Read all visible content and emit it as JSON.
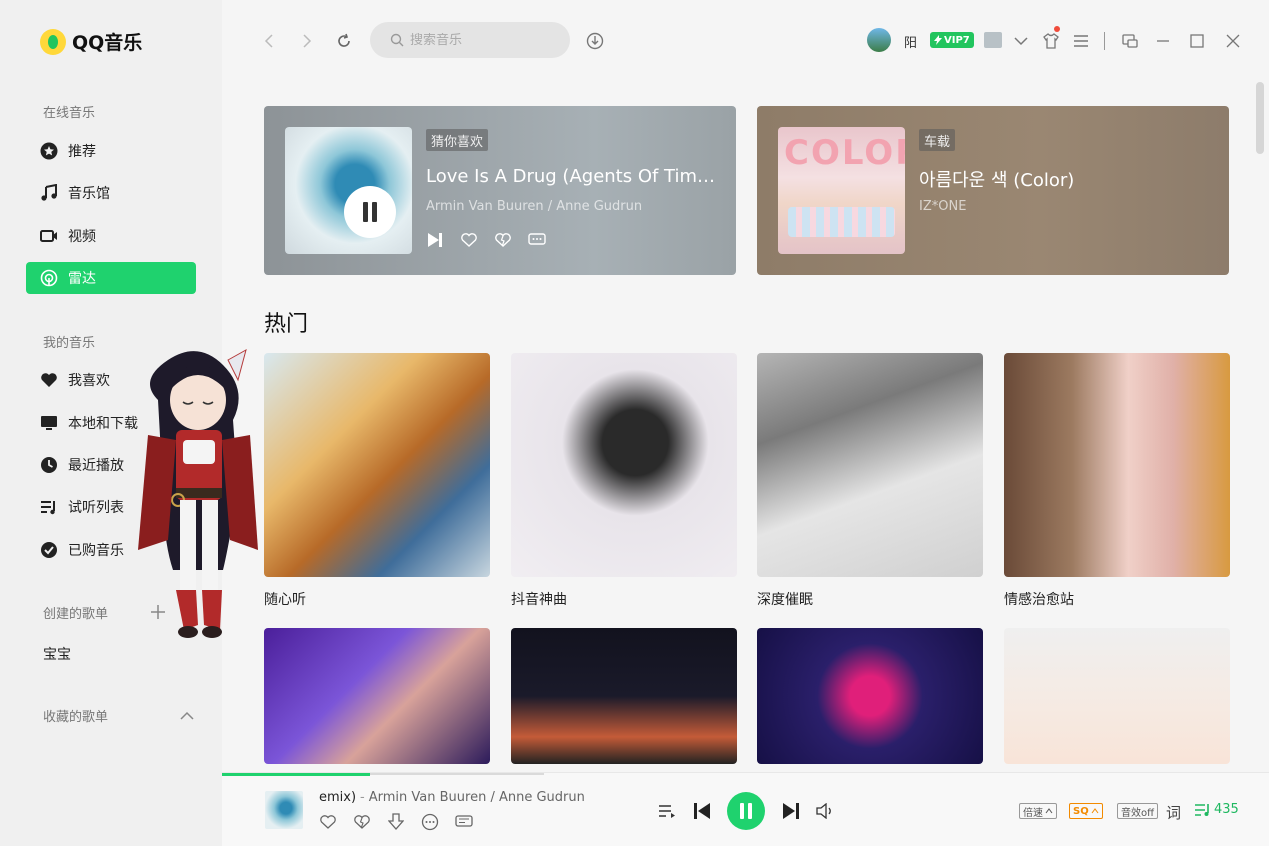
{
  "app": {
    "name": "QQ音乐",
    "accent": "#1fd26e"
  },
  "sidebar": {
    "online_label": "在线音乐",
    "online_items": [
      {
        "label": "推荐",
        "icon": "star-icon"
      },
      {
        "label": "音乐馆",
        "icon": "music-note-icon"
      },
      {
        "label": "视频",
        "icon": "video-icon"
      },
      {
        "label": "雷达",
        "icon": "radar-icon",
        "active": true
      }
    ],
    "my_label": "我的音乐",
    "my_items": [
      {
        "label": "我喜欢",
        "icon": "heart-icon"
      },
      {
        "label": "本地和下载",
        "icon": "monitor-icon"
      },
      {
        "label": "最近播放",
        "icon": "clock-icon"
      },
      {
        "label": "试听列表",
        "icon": "playlist-icon"
      },
      {
        "label": "已购音乐",
        "icon": "check-circle-icon"
      }
    ],
    "created_label": "创建的歌单",
    "created_playlists": [
      "宝宝"
    ],
    "collected_label": "收藏的歌单"
  },
  "topbar": {
    "search_placeholder": "搜索音乐",
    "username": "阳",
    "vip_label": "VIP7"
  },
  "now_cards": [
    {
      "tag": "猜你喜欢",
      "title": "Love Is A Drug (Agents Of Time Remix)",
      "artist": "Armin Van Buuren / Anne Gudrun",
      "playing": true
    },
    {
      "tag": "车载",
      "title": "아름다운 색 (Color)",
      "artist": "IZ*ONE",
      "cover_text": "COLOR*IZ"
    }
  ],
  "hot": {
    "title": "热门",
    "tiles": [
      "随心听",
      "抖音神曲",
      "深度催眠",
      "情感治愈站",
      "",
      "",
      "",
      ""
    ]
  },
  "player": {
    "title_fragment": "emix)",
    "separator": "-",
    "artist": "Armin Van Buuren / Anne Gudrun",
    "progress": 0.46,
    "speed_label": "倍速",
    "quality_label": "SQ",
    "effect_label": "音效off",
    "lyric_label": "词",
    "queue_count": "435"
  }
}
